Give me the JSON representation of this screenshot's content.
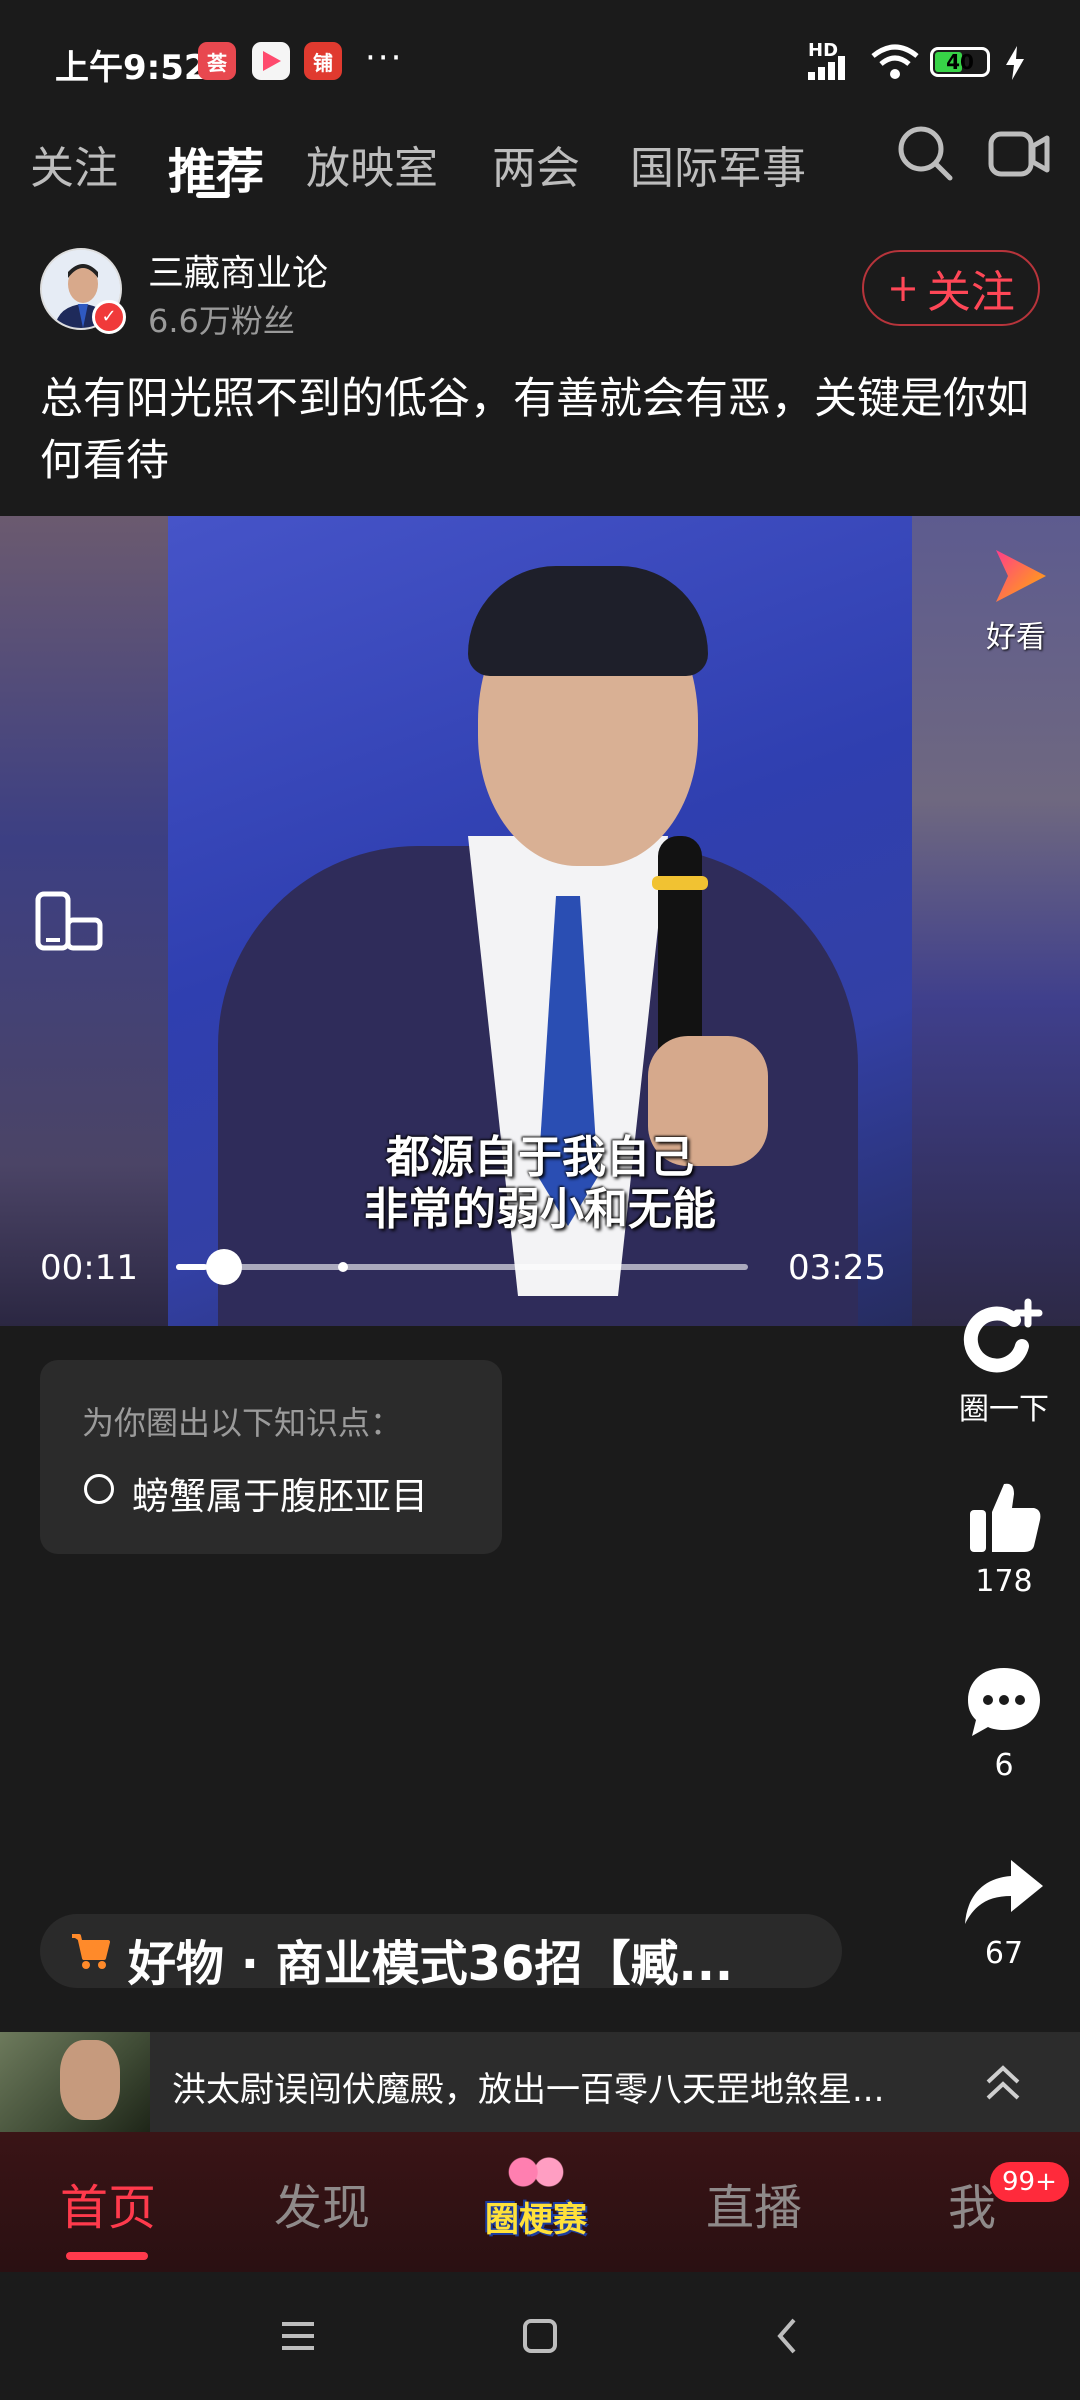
{
  "status_bar": {
    "time": "上午9:52",
    "more": "···",
    "hd": "HD",
    "battery": "40"
  },
  "tabs": [
    {
      "label": "关注"
    },
    {
      "label": "推荐"
    },
    {
      "label": "放映室"
    },
    {
      "label": "两会"
    },
    {
      "label": "国际军事"
    }
  ],
  "author": {
    "name": "三藏商业论",
    "fans": "6.6万粉丝",
    "follow_label": "关注",
    "follow_plus": "+"
  },
  "caption": "总有阳光照不到的低谷，有善就会有恶，关键是你如何看待",
  "video": {
    "subtitle_line1": "都源自于我自己",
    "subtitle_line2": "非常的弱小和无能",
    "current_time": "00:11",
    "total_time": "03:25",
    "progress_fraction": 0.054,
    "watermark": "好看"
  },
  "knowledge": {
    "title": "为你圈出以下知识点：",
    "item": "螃蟹属于腹胚亚目"
  },
  "actions": {
    "circle_label": "圈一下",
    "likes": "178",
    "comments": "6",
    "shares": "67"
  },
  "goods": {
    "text": "好物 · 商业模式36招【臧..."
  },
  "mini_player": {
    "title": "洪太尉误闯伏魔殿，放出一百零八天罡地煞星..."
  },
  "bottom_nav": {
    "home": "首页",
    "discover": "发现",
    "center": "圈梗赛",
    "live": "直播",
    "me": "我",
    "badge": "99+"
  },
  "colors": {
    "accent_red": "#ff3a4c",
    "background": "#1b1b1b"
  }
}
